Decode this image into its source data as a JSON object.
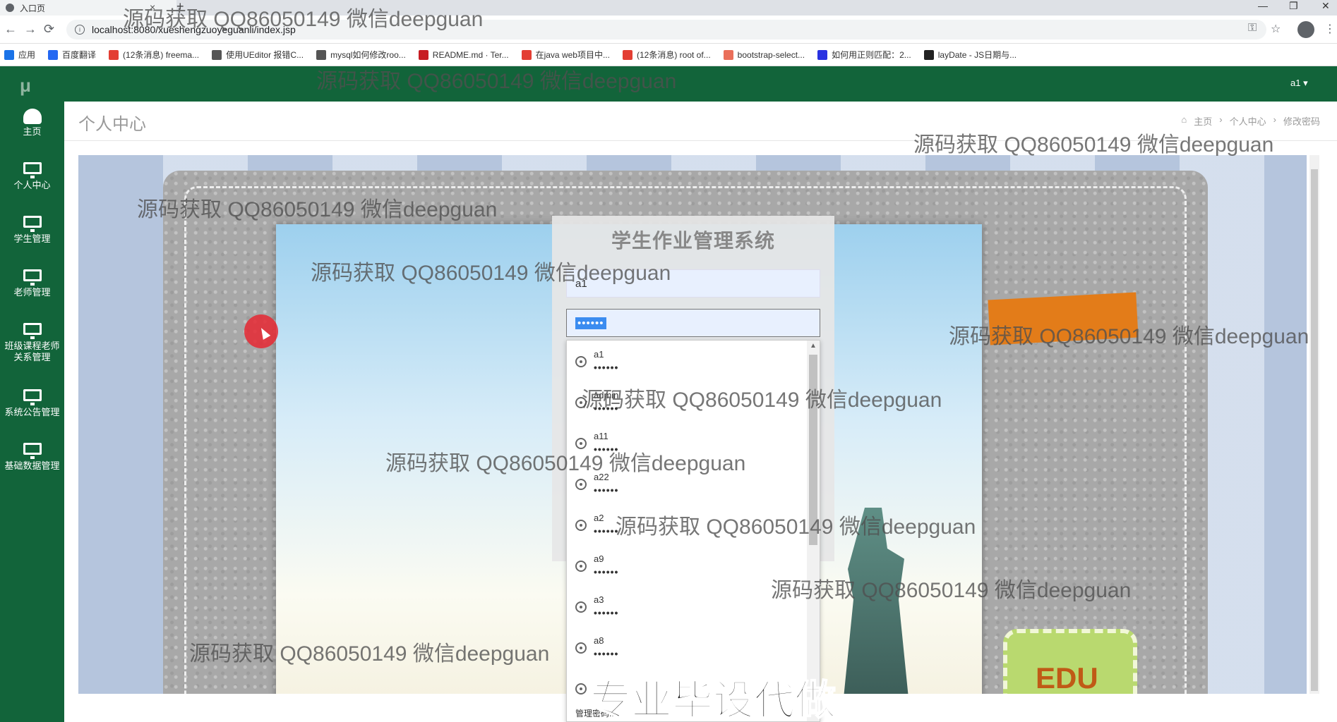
{
  "browser": {
    "tab_title": "入口页",
    "close_glyph": "×",
    "new_tab_glyph": "+",
    "url": "localhost:8080/xueshengzuoyeguanli/index.jsp",
    "back_glyph": "←",
    "forward_glyph": "→",
    "reload_glyph": "⟳",
    "key_glyph": "⚿",
    "star_glyph": "☆",
    "menu_glyph": "⋮",
    "min_glyph": "—",
    "restore_glyph": "❐",
    "close_window_glyph": "✕",
    "bookmarks": [
      {
        "label": "应用",
        "icon": "apps-grid-icon",
        "color": "#1a73e8"
      },
      {
        "label": "百度翻译",
        "icon": "baidu-translate-icon",
        "color": "#2468f2"
      },
      {
        "label": "(12条消息) freema...",
        "icon": "csdn-icon",
        "color": "#e33e33"
      },
      {
        "label": "使用UEditor 报错C...",
        "icon": "ueditor-icon",
        "color": "#555555"
      },
      {
        "label": "mysql如何修改roo...",
        "icon": "mysql-icon",
        "color": "#555555"
      },
      {
        "label": "README.md · Ter...",
        "icon": "gitee-icon",
        "color": "#c71d23"
      },
      {
        "label": "在java web项目中...",
        "icon": "csdn-icon",
        "color": "#e33e33"
      },
      {
        "label": "(12条消息) root of...",
        "icon": "csdn-icon",
        "color": "#e33e33"
      },
      {
        "label": "bootstrap-select...",
        "icon": "jianshu-icon",
        "color": "#ea6f5a"
      },
      {
        "label": "如何用正则匹配：2...",
        "icon": "baidu-paw-icon",
        "color": "#2932e1"
      },
      {
        "label": "layDate - JS日期与...",
        "icon": "layui-icon",
        "color": "#222222"
      }
    ]
  },
  "app": {
    "logo": "μ",
    "user_menu": "a1 ▾",
    "sidebar": [
      {
        "label": "主页",
        "icon": "dashboard-icon"
      },
      {
        "label": "个人中心",
        "icon": "monitor-icon"
      },
      {
        "label": "学生管理",
        "icon": "monitor-icon"
      },
      {
        "label": "老师管理",
        "icon": "monitor-icon"
      },
      {
        "label": "班级课程老师\n关系管理",
        "icon": "monitor-icon"
      },
      {
        "label": "系统公告管理",
        "icon": "monitor-icon"
      },
      {
        "label": "基础数据管理",
        "icon": "monitor-icon"
      }
    ],
    "page_title": "个人中心",
    "breadcrumb": [
      "主页",
      "个人中心",
      "修改密码"
    ],
    "breadcrumb_sep": "›",
    "home_glyph": "⌂"
  },
  "login": {
    "title": "学生作业管理系统",
    "username_value": "a1",
    "password_value": "••••••"
  },
  "autocomplete": {
    "items": [
      {
        "user": "a1",
        "pass": "••••••"
      },
      {
        "user": "admin",
        "pass": "••••••"
      },
      {
        "user": "a11",
        "pass": "••••••"
      },
      {
        "user": "a22",
        "pass": "••••••"
      },
      {
        "user": "a2",
        "pass": "••••••"
      },
      {
        "user": "a9",
        "pass": "••••••"
      },
      {
        "user": "a3",
        "pass": "••••••"
      },
      {
        "user": "a8",
        "pass": "••••••"
      },
      {
        "user": "",
        "pass": ""
      }
    ],
    "footer": "管理密码...",
    "scroll_up_glyph": "▲"
  },
  "decor": {
    "edu_text": "EDU"
  },
  "overlay": {
    "watermark": "源码获取 QQ86050149 微信deepguan",
    "banner": "专业毕设代做"
  }
}
